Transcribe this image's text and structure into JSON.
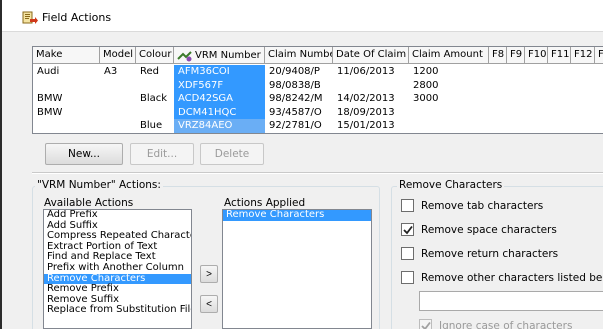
{
  "window": {
    "title": "Field Actions"
  },
  "grid": {
    "columns": [
      "Make",
      "Model",
      "Colour",
      "VRM Number",
      "Claim Number",
      "Date Of Claim",
      "Claim Amount",
      "F8",
      "F9",
      "F10",
      "F11",
      "F12",
      "F"
    ],
    "rows": [
      [
        "Audi",
        "A3",
        "Red",
        "AFM36COI",
        "20/9408/P",
        "11/06/2013",
        "1200"
      ],
      [
        "",
        "",
        "",
        "XDF567F",
        "98/0838/B",
        "",
        "2800"
      ],
      [
        "BMW",
        "",
        "Black",
        "ACD42SGA",
        "98/8242/M",
        "14/02/2013",
        "3000"
      ],
      [
        "BMW",
        "",
        "",
        "DCM41HQC",
        "93/4587/O",
        "18/09/2013",
        ""
      ],
      [
        "",
        "",
        "Blue",
        "VRZ84AEO",
        "92/2781/O",
        "15/01/2013",
        ""
      ]
    ]
  },
  "buttons": {
    "new": "New...",
    "edit": "Edit...",
    "delete": "Delete"
  },
  "actions_group": {
    "title": "\"VRM Number\" Actions:",
    "available_label": "Available Actions",
    "applied_label": "Actions Applied",
    "available": [
      "Add Prefix",
      "Add Suffix",
      "Compress Repeated Characters",
      "Extract Portion of Text",
      "Find and Replace Text",
      "Prefix with Another Column",
      "Remove Characters",
      "Remove Prefix",
      "Remove Suffix",
      "Replace from Substitution File"
    ],
    "available_selected_index": 6,
    "applied": [
      "Remove Characters"
    ],
    "add_button": ">",
    "remove_button": "<"
  },
  "remove_group": {
    "title": "Remove Characters",
    "options": [
      {
        "label": "Remove tab characters",
        "checked": false
      },
      {
        "label": "Remove space characters",
        "checked": true
      },
      {
        "label": "Remove return characters",
        "checked": false
      },
      {
        "label": "Remove other characters listed below:",
        "checked": false
      }
    ],
    "other_chars_value": "",
    "ignore_case": {
      "label": "Ignore case of characters",
      "checked": true,
      "disabled": true
    }
  },
  "colors": {
    "selection": "#3399ff",
    "window_bg": "#f0f0f0"
  }
}
